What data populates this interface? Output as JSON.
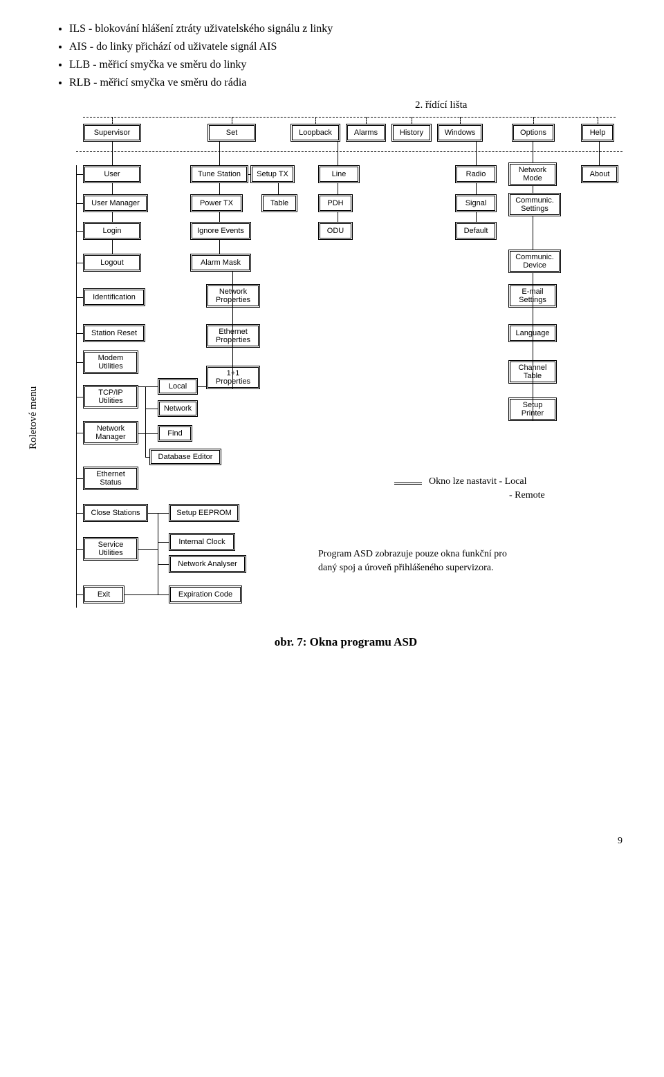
{
  "bullets": {
    "b0": "ILS - blokování hlášení ztráty uživatelského signálu z linky",
    "b1": "AIS - do linky přichází od uživatele signál AIS",
    "b2": "LLB - měřicí smyčka ve směru do linky",
    "b3": "RLB - měřicí smyčka ve směru do rádia"
  },
  "labels": {
    "ridici": "2. řídící lišta",
    "side": "Roletové menu"
  },
  "top": {
    "supervisor": "Supervisor",
    "set": "Set",
    "loopback": "Loopback",
    "alarms": "Alarms",
    "history": "History",
    "windows": "Windows",
    "options": "Options",
    "help": "Help"
  },
  "n": {
    "user": "User",
    "tune": "Tune Station",
    "setuptx": "Setup TX",
    "line": "Line",
    "radio": "Radio",
    "netmode": "Network Mode",
    "about": "About",
    "usermgr": "User Manager",
    "powertx": "Power TX",
    "table": "Table",
    "pdh": "PDH",
    "signal": "Signal",
    "cset": "Communic. Settings",
    "login": "Login",
    "ignore": "Ignore Events",
    "odu": "ODU",
    "default": "Default",
    "logout": "Logout",
    "mask": "Alarm Mask",
    "cdev": "Communic. Device",
    "ident": "Identification",
    "netprop": "Network Properties",
    "email": "E-mail Settings",
    "sreset": "Station Reset",
    "ethprop": "Ethernet Properties",
    "lang": "Language",
    "modem": "Modem Utilities",
    "p11": "1+1 Properties",
    "chtbl": "Channel Table",
    "tcp": "TCP/IP Utilities",
    "local": "Local",
    "network": "Network",
    "setpr": "Setup Printer",
    "netmgr": "Network Manager",
    "find": "Find",
    "dbedit": "Database Editor",
    "ethst": "Ethernet Status",
    "closest": "Close Stations",
    "eeprom": "Setup EEPROM",
    "svc": "Service Utilities",
    "iclock": "Internal Clock",
    "nanal": "Network  Analyser",
    "exit": "Exit",
    "expcode": "Expiration Code"
  },
  "notes": {
    "okno1": "Okno lze nastavit  - Local",
    "okno2": "- Remote",
    "prog1": "Program ASD zobrazuje pouze okna funkční pro",
    "prog2": "daný spoj a úroveň přihlášeného supervizora."
  },
  "caption": "obr. 7: Okna programu ASD",
  "pagenum": "9"
}
